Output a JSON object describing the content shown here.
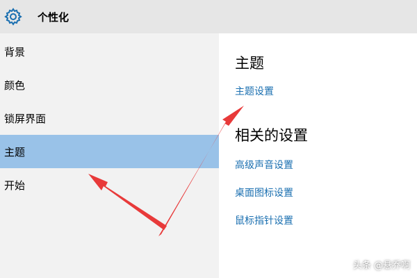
{
  "window": {
    "title": "个性化",
    "icon": "gear-icon"
  },
  "sidebar": {
    "items": [
      {
        "label": "背景",
        "selected": false
      },
      {
        "label": "颜色",
        "selected": false
      },
      {
        "label": "锁屏界面",
        "selected": false
      },
      {
        "label": "主题",
        "selected": true
      },
      {
        "label": "开始",
        "selected": false
      }
    ],
    "selected_color": "#99c2e8"
  },
  "main": {
    "heading": "主题",
    "theme_settings_link": "主题设置",
    "related_heading": "相关的设置",
    "related_links": [
      "高级声音设置",
      "桌面图标设置",
      "鼠标指针设置"
    ],
    "link_color": "#1a6fb0"
  },
  "annotation": {
    "arrow_color": "#e83a3a"
  },
  "watermark": {
    "text": "头条 @悬乔啊"
  }
}
